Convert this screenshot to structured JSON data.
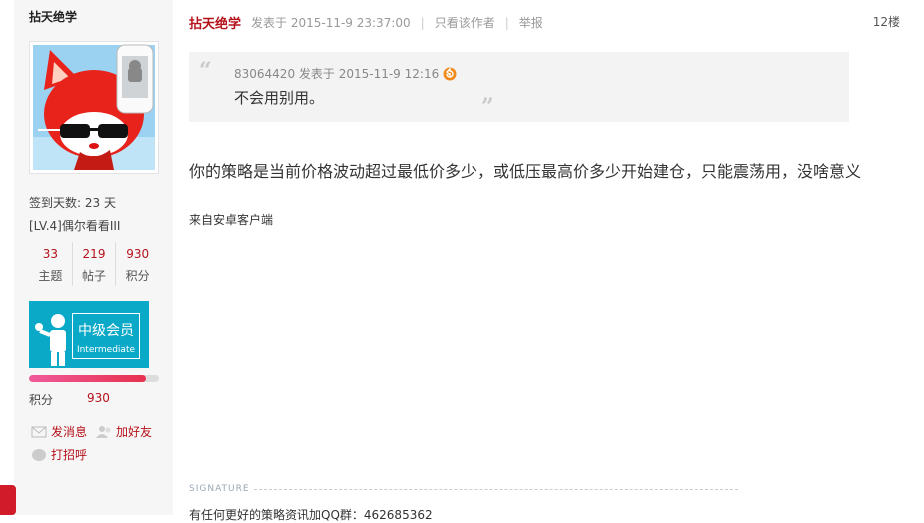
{
  "sidebar": {
    "username": "拈天绝学",
    "sign_days": "签到天数: 23 天",
    "level": "[LV.4]偶尔看看III",
    "stats": [
      {
        "value": "33",
        "label": "主题"
      },
      {
        "value": "219",
        "label": "帖子"
      },
      {
        "value": "930",
        "label": "积分"
      }
    ],
    "badge_title": "中级会员",
    "badge_sub": "Intermediate",
    "progress_fraction": 0.9,
    "points_label": "积分",
    "points_value": "930",
    "send_msg": "发消息",
    "add_friend": "加好友",
    "greet": "打招呼"
  },
  "post": {
    "author": "拈天绝学",
    "posted": "发表于 2015-11-9 23:37:00",
    "only_author": "只看该作者",
    "report": "举报",
    "floor": "12楼",
    "quote": {
      "meta": "83064420 发表于 2015-11-9 12:16",
      "text": "不会用别用。"
    },
    "body": "你的策略是当前价格波动超过最低价多少，或低压最高价多少开始建仓，只能震荡用，没啥意义",
    "source": "来自安卓客户端",
    "signature_label": "SIGNATURE",
    "signature_text": "有任何更好的策略资讯加QQ群：462685362"
  },
  "colors": {
    "accent": "#b5121b",
    "badge": "#0aa9c8",
    "quote_bg": "#f3f3f3",
    "sidebar_bg": "#f6f6f6"
  }
}
